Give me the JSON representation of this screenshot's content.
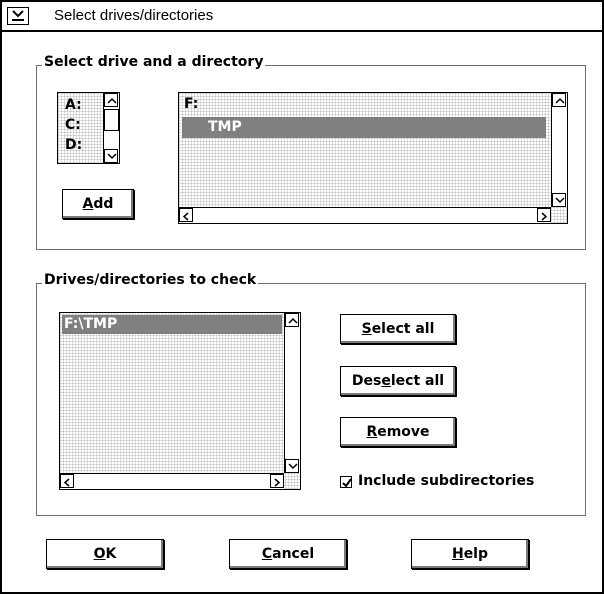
{
  "window": {
    "title": "Select drives/directories",
    "system_menu_icon": "chevron-down-icon"
  },
  "select_group": {
    "label": "Select drive and a directory",
    "drives": [
      "A:",
      "C:",
      "D:"
    ],
    "directory_path": "F:",
    "directories": [
      {
        "label": "TMP",
        "selected": true
      }
    ],
    "add_button": {
      "mnemonic": "A",
      "rest": "dd"
    }
  },
  "check_group": {
    "label": "Drives/directories to check",
    "items": [
      {
        "label": "F:\\TMP",
        "selected": true
      }
    ],
    "buttons": {
      "select_all": {
        "prefix": "",
        "mnemonic": "S",
        "rest": "elect all"
      },
      "deselect_all": {
        "prefix": "Des",
        "mnemonic": "e",
        "rest": "lect all"
      },
      "remove": {
        "prefix": "",
        "mnemonic": "R",
        "rest": "emove"
      }
    },
    "include_subdirectories": {
      "label": "Include subdirectories",
      "checked": true
    }
  },
  "footer": {
    "ok": {
      "mnemonic": "O",
      "rest": "K"
    },
    "cancel": {
      "mnemonic": "C",
      "rest": "ancel"
    },
    "help": {
      "mnemonic": "H",
      "rest": "elp"
    }
  },
  "colors": {
    "selection": "#808080",
    "border": "#000000",
    "shadow": "#7a7a7a"
  }
}
